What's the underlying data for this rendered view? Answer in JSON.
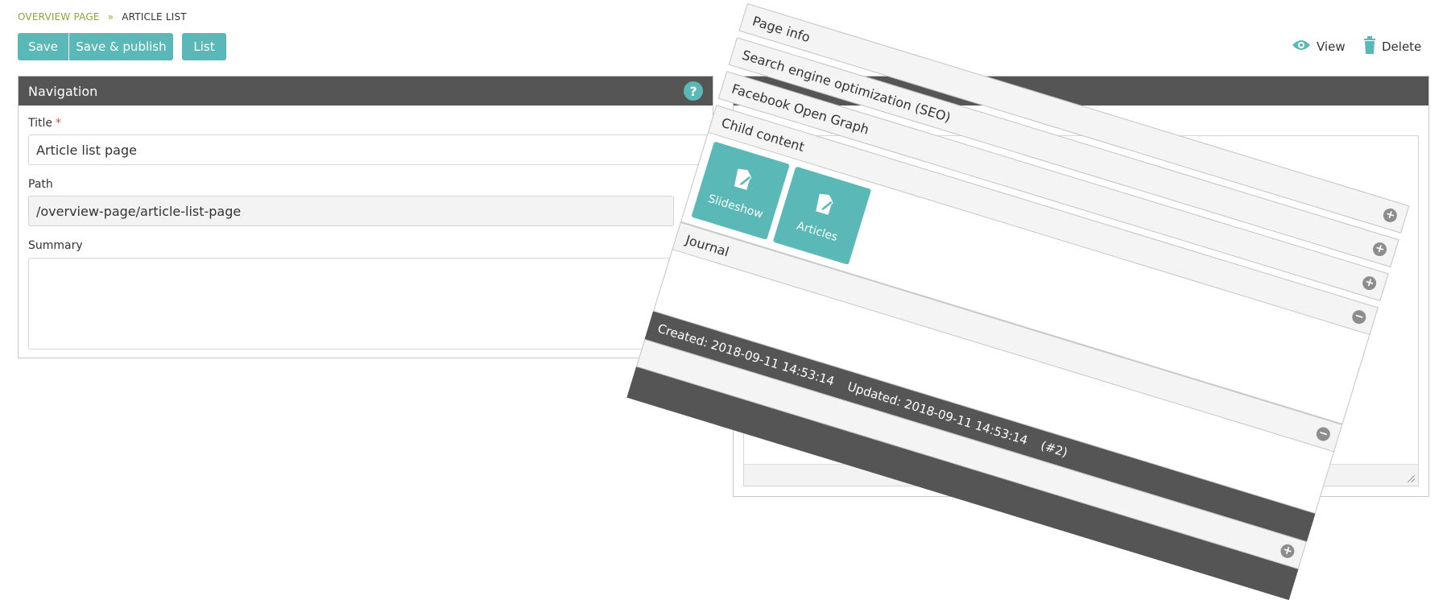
{
  "breadcrumb": {
    "parent": "OVERVIEW PAGE",
    "separator": "»",
    "current": "ARTICLE LIST"
  },
  "toolbar": {
    "save_label": "Save",
    "save_publish_label": "Save & publish",
    "list_label": "List",
    "view_label": "View",
    "delete_label": "Delete"
  },
  "navigation": {
    "title": "Navigation",
    "help_icon": "?",
    "title_label": "Title",
    "required_mark": "*",
    "title_value": "Article list page",
    "path_label": "Path",
    "path_value": "/overview-page/article-list-page",
    "summary_label": "Summary",
    "summary_value": ""
  },
  "accordion": {
    "page_info": "Page info",
    "seo": "Search engine optimization (SEO)",
    "facebook": "Facebook Open Graph",
    "child_content": "Child content",
    "journal": "Journal",
    "expand_symbol": "+",
    "collapse_symbol": "−"
  },
  "child_tiles": [
    {
      "label": "Slideshow",
      "icon": "edit-icon"
    },
    {
      "label": "Articles",
      "icon": "edit-icon"
    }
  ],
  "meta": {
    "created": "Created: 2018-09-11 14:53:14",
    "updated": "Updated: 2018-09-11 14:53:14",
    "id": "(#2)"
  },
  "colors": {
    "accent": "#5ab9b7",
    "breadcrumb": "#8aa832",
    "header": "#555555",
    "required": "#d9534f"
  }
}
